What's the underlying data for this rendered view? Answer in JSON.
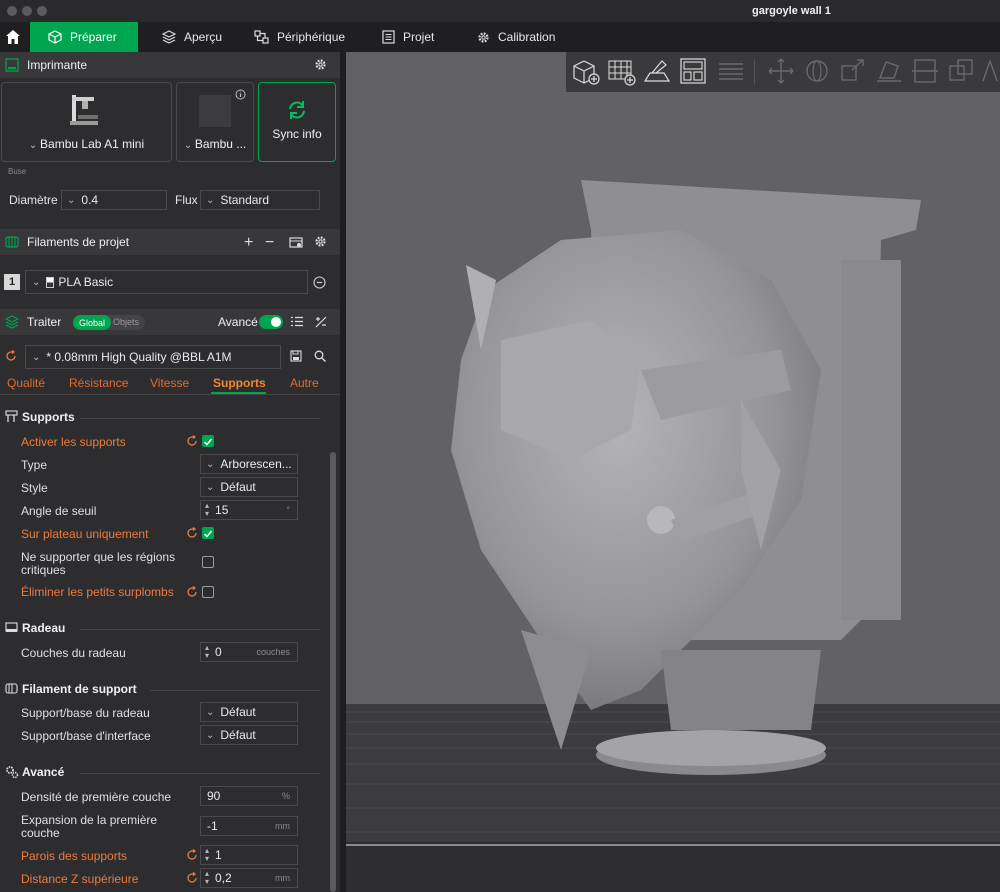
{
  "window": {
    "title": "gargoyle wall 1"
  },
  "tabs": [
    {
      "label": "Préparer",
      "icon": "cube-icon"
    },
    {
      "label": "Aperçu",
      "icon": "layers-icon"
    },
    {
      "label": "Périphérique",
      "icon": "device-icon"
    },
    {
      "label": "Projet",
      "icon": "document-icon"
    },
    {
      "label": "Calibration",
      "icon": "gear-icon"
    }
  ],
  "printer": {
    "section_title": "Imprimante",
    "printer_name": "Bambu Lab A1 mini",
    "plate_name": "Bambu ...",
    "sync_label": "Sync info",
    "nozzle_label": "Buse",
    "diameter_label": "Diamètre",
    "diameter_value": "0.4",
    "flow_label": "Flux",
    "flow_value": "Standard"
  },
  "filaments": {
    "section_title": "Filaments de projet",
    "items": [
      {
        "index": "1",
        "name": "PLA Basic"
      }
    ]
  },
  "process": {
    "section_title": "Traiter",
    "toggle_global": "Global",
    "toggle_objects": "Objets",
    "advanced_label": "Avancé",
    "advanced_on": true,
    "preset": "* 0.08mm High Quality @BBL A1M",
    "subtabs": [
      "Qualité",
      "Résistance",
      "Vitesse",
      "Supports",
      "Autre"
    ],
    "active_subtab": "Supports"
  },
  "settings": {
    "supports": {
      "title": "Supports",
      "enable_label": "Activer les supports",
      "enable_value": true,
      "type_label": "Type",
      "type_value": "Arborescen...",
      "style_label": "Style",
      "style_value": "Défaut",
      "threshold_label": "Angle de seuil",
      "threshold_value": "15",
      "threshold_unit": "°",
      "on_plate_label": "Sur plateau uniquement",
      "on_plate_value": true,
      "critical_label": "Ne supporter que les régions critiques",
      "critical_value": false,
      "remove_small_label": "Éliminer les petits surplombs",
      "remove_small_value": false
    },
    "raft": {
      "title": "Radeau",
      "layers_label": "Couches du radeau",
      "layers_value": "0",
      "layers_unit": "couches"
    },
    "support_filament": {
      "title": "Filament de support",
      "raft_base_label": "Support/base du radeau",
      "raft_base_value": "Défaut",
      "interface_label": "Support/base d'interface",
      "interface_value": "Défaut"
    },
    "advanced": {
      "title": "Avancé",
      "first_density_label": "Densité de première couche",
      "first_density_value": "90",
      "first_density_unit": "%",
      "first_expansion_label": "Expansion de la première couche",
      "first_expansion_value": "-1",
      "first_expansion_unit": "mm",
      "walls_label": "Parois des supports",
      "walls_value": "1",
      "top_z_label": "Distance Z supérieure",
      "top_z_value": "0,2",
      "top_z_unit": "mm"
    }
  },
  "colors": {
    "accent": "#00a54f",
    "modified": "#f07a3a",
    "panel": "#2d2d30",
    "viewport": "#626264"
  }
}
